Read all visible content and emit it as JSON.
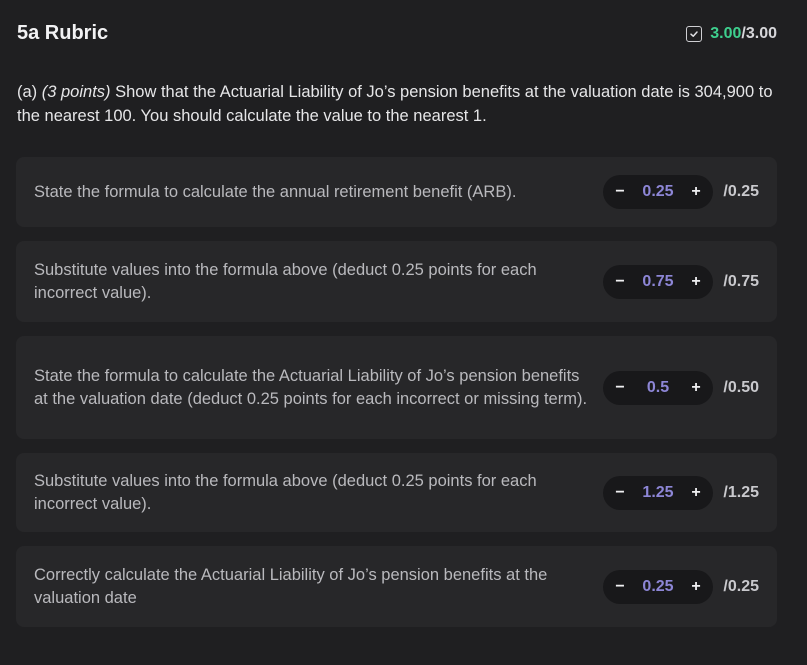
{
  "header": {
    "title": "5a Rubric",
    "score": "3.00",
    "score_total": "/3.00"
  },
  "question": {
    "prefix": "(a) ",
    "points": "(3 points)",
    "text": " Show that the Actuarial Liability of Jo’s pension benefits at the valuation date is 304,900 to the nearest 100. You should calculate the value to the nearest 1."
  },
  "stepper": {
    "minus": "−",
    "plus": "+"
  },
  "items": [
    {
      "text": "State the formula to calculate the annual retirement benefit (ARB).",
      "value": "0.25",
      "max": "/0.25"
    },
    {
      "text": "Substitute values into the formula above (deduct 0.25 points for each incorrect value).",
      "value": "0.75",
      "max": "/0.75"
    },
    {
      "text": "State the formula to calculate the Actuarial Liability of Jo’s pension benefits at the valuation date (deduct 0.25 points for each incorrect or missing term).",
      "value": "0.5",
      "max": "/0.50"
    },
    {
      "text": "Substitute values into the formula above (deduct 0.25 points for each incorrect value).",
      "value": "1.25",
      "max": "/1.25"
    },
    {
      "text": "Correctly calculate the Actuarial Liability of Jo’s pension benefits at the valuation date",
      "value": "0.25",
      "max": "/0.25"
    }
  ]
}
